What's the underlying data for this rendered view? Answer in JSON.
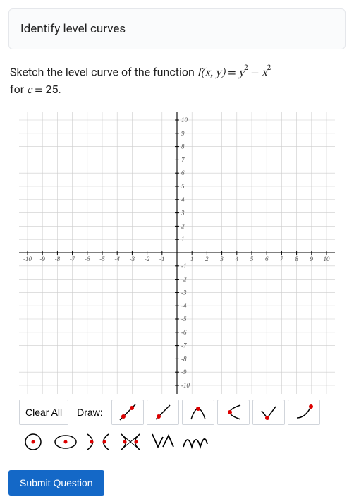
{
  "card_title": "Identify level curves",
  "prompt": {
    "p1": "Sketch the level curve of the function ",
    "fn_lhs": "f(x, y)",
    "eq": " = ",
    "fn_rhs_y": "y",
    "fn_rhs_minus": " − ",
    "fn_rhs_x": "x",
    "sup": "2",
    "p2": "for ",
    "c_lhs": "c",
    "c_eq": " = ",
    "c_val": "25",
    "dot": "."
  },
  "toolbar": {
    "clear_all": "Clear All",
    "draw_label": "Draw:"
  },
  "axis": {
    "xmin": -10,
    "xmax": 10,
    "ymin": -10,
    "ymax": 10,
    "xticks": [
      -10,
      -9,
      -8,
      -7,
      -6,
      -5,
      -4,
      -3,
      -2,
      -1,
      1,
      2,
      3,
      4,
      5,
      6,
      7,
      8,
      9,
      10
    ],
    "yticks": [
      10,
      9,
      8,
      7,
      6,
      5,
      4,
      3,
      2,
      1,
      -1,
      -2,
      -3,
      -4,
      -5,
      -6,
      -7,
      -8,
      -9,
      -10
    ]
  },
  "submit_label": "Submit Question",
  "chart_data": {
    "type": "scatter",
    "title": "",
    "xlabel": "",
    "ylabel": "",
    "xlim": [
      -10,
      10
    ],
    "ylim": [
      -10,
      10
    ],
    "series": []
  }
}
